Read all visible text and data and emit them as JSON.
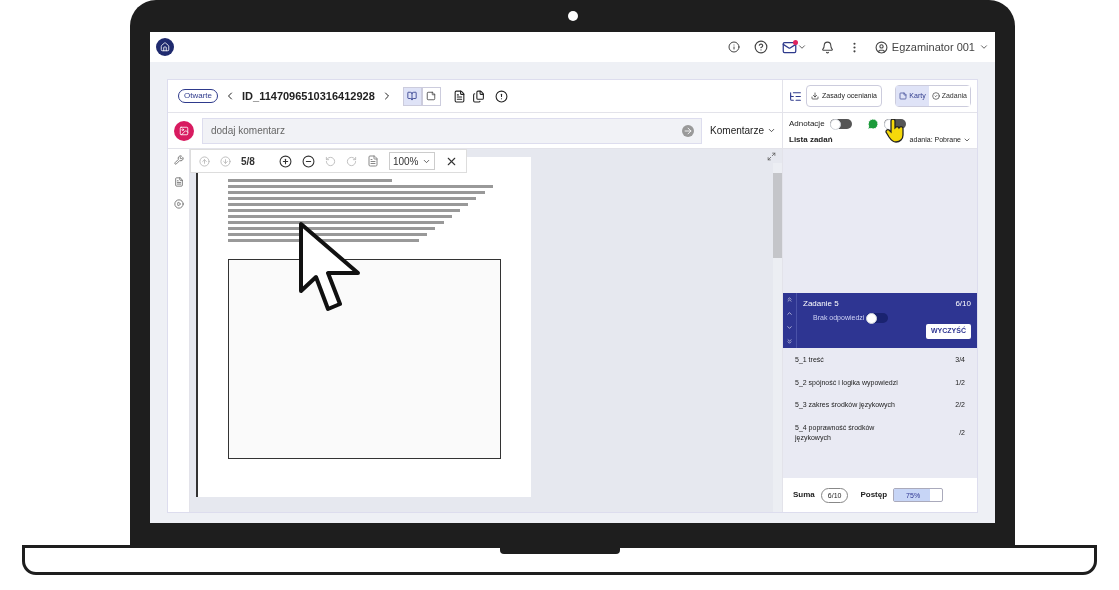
{
  "top_bar": {
    "user": "Egzaminator 001",
    "mail_unread": true
  },
  "header": {
    "status": "Otwarte",
    "id": "ID_1147096510316412928",
    "view_modes": [
      {
        "selected": true
      },
      {
        "selected": false
      }
    ]
  },
  "right_header": {
    "rules_button": "Zasady oceniania",
    "tabs": [
      {
        "label": "Karty",
        "selected": true
      },
      {
        "label": "Zadania",
        "selected": false
      }
    ]
  },
  "comment": {
    "placeholder": "dodaj komentarz",
    "filter": "Komentarze"
  },
  "annotations": {
    "label": "Adnotacje",
    "on": false,
    "second_on": false
  },
  "task_list": {
    "title": "Lista zadań",
    "filter": "adania: Pobrane"
  },
  "viewer": {
    "page": "5/8",
    "zoom": "100%"
  },
  "task": {
    "title": "Zadanie 5",
    "score": "6/10",
    "no_answer_label": "Brak odpowiedzi",
    "no_answer": false,
    "clear": "WYCZYŚĆ"
  },
  "criteria": [
    {
      "name": "5_1 treść",
      "score": "3/4"
    },
    {
      "name": "5_2 spójność i logika wypowiedzi",
      "score": "1/2"
    },
    {
      "name": "5_3 zakres środków językowych",
      "score": "2/2"
    },
    {
      "name": "5_4 poprawność środków językowych",
      "score": "/2"
    }
  ],
  "footer": {
    "sum_label": "Suma",
    "sum": "6/10",
    "progress_label": "Postęp",
    "progress": "75%",
    "level": 0.75
  }
}
